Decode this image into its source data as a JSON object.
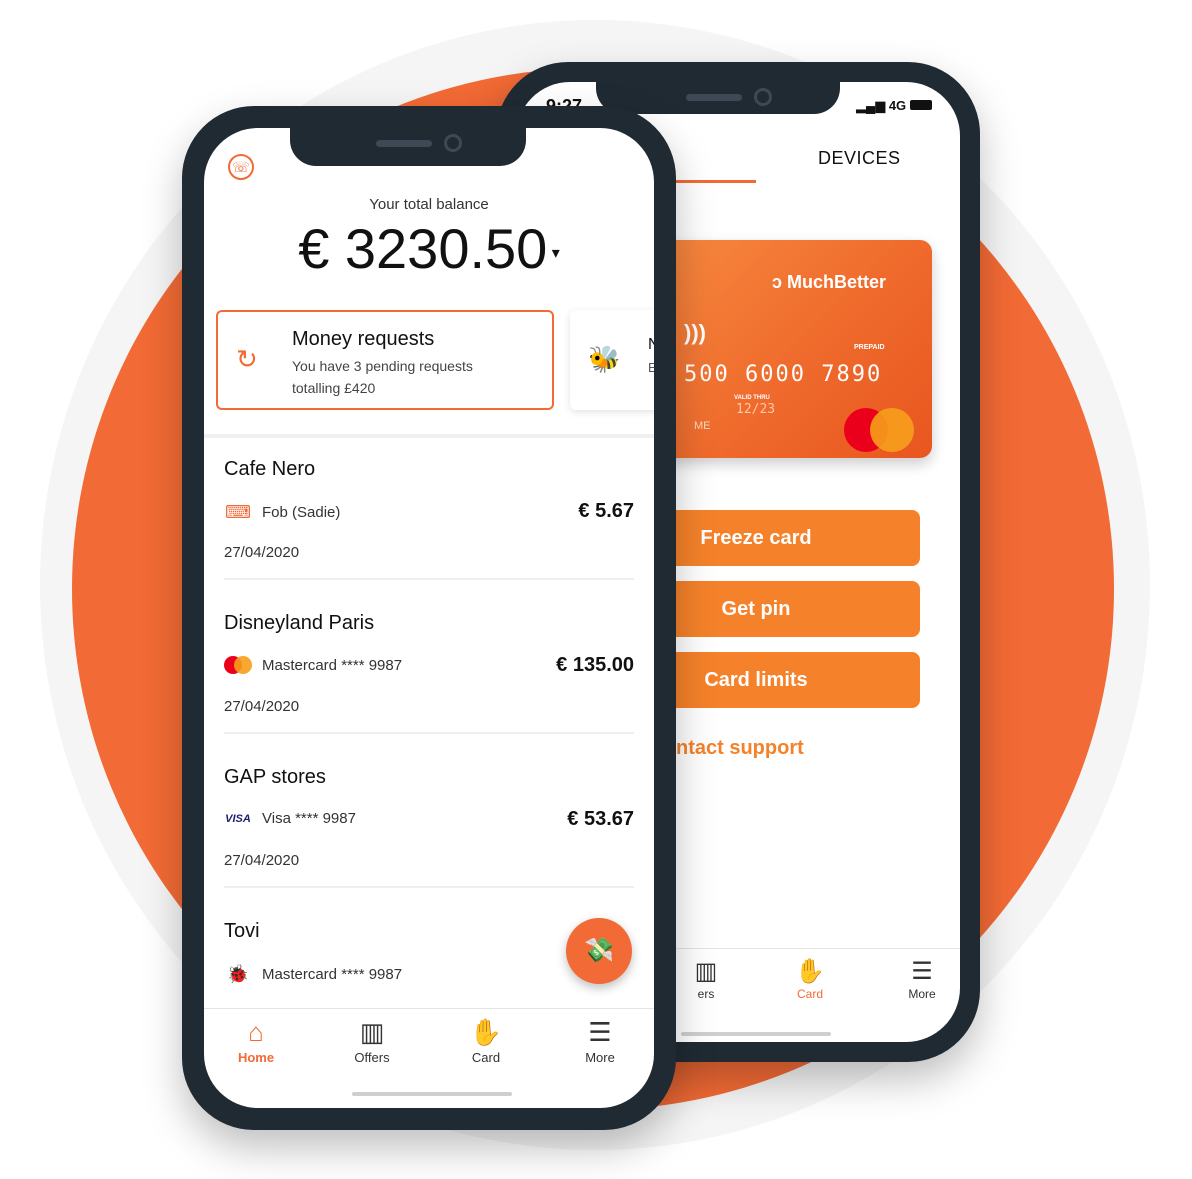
{
  "colors": {
    "brand_orange": "#F26A35",
    "button_orange": "#F5822A",
    "phone_frame": "#1f2a33"
  },
  "back_phone": {
    "status_time": "9:27",
    "status_network": "4G",
    "tab_label": "DEVICES",
    "card": {
      "brand": "MuchBetter",
      "type_label": "PREPAID",
      "number_visible": "500 6000 7890",
      "valid_thru_label": "VALID THRU",
      "expiry": "12/23",
      "name_visible": "ME",
      "network": "Mastercard"
    },
    "buttons": {
      "freeze": "Freeze card",
      "get_pin": "Get pin",
      "limits": "Card limits"
    },
    "support_link": "ntact support",
    "nav": [
      {
        "label": "ers",
        "icon": "offers-icon"
      },
      {
        "label": "Card",
        "icon": "card-icon"
      },
      {
        "label": "More",
        "icon": "menu-icon"
      }
    ]
  },
  "front_phone": {
    "balance_label": "Your total balance",
    "balance_value": "€ 3230.50",
    "money_requests": {
      "title": "Money requests",
      "line1": "You have 3 pending requests",
      "line2": "totalling £420"
    },
    "second_card_letter": "N",
    "second_card_sub": "E",
    "transactions": [
      {
        "name": "Cafe Nero",
        "method": "Fob (Sadie)",
        "method_icon": "fob-icon",
        "amount": "€ 5.67",
        "date": "27/04/2020"
      },
      {
        "name": "Disneyland Paris",
        "method": "Mastercard  **** 9987",
        "method_icon": "mastercard-icon",
        "amount": "€ 135.00",
        "date": "27/04/2020"
      },
      {
        "name": "GAP stores",
        "method": "Visa  **** 9987",
        "method_icon": "visa-icon",
        "amount": "€ 53.67",
        "date": "27/04/2020"
      },
      {
        "name": "Tovi",
        "method": "Mastercard  **** 9987",
        "method_icon": "bug-icon",
        "amount": "",
        "date": ""
      }
    ],
    "nav": [
      {
        "label": "Home",
        "icon": "home-icon"
      },
      {
        "label": "Offers",
        "icon": "offers-icon"
      },
      {
        "label": "Card",
        "icon": "card-icon"
      },
      {
        "label": "More",
        "icon": "menu-icon"
      }
    ]
  }
}
